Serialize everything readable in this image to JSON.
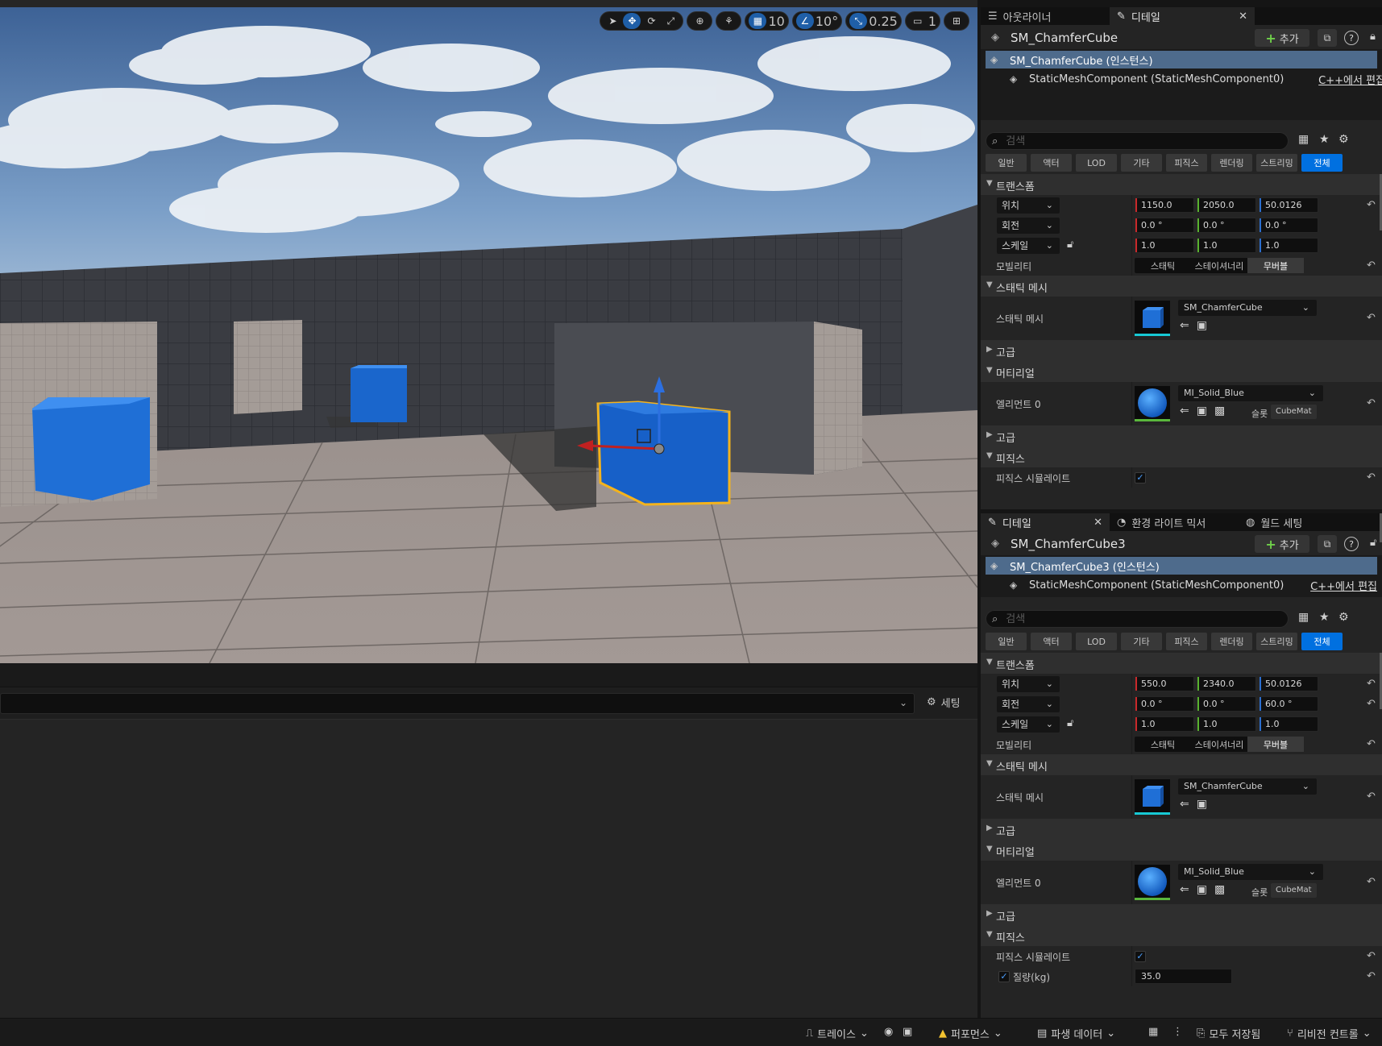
{
  "viewport": {
    "toolbar": {
      "grid_snap": "10",
      "angle_snap": "10°",
      "scale_snap": "0.25",
      "camera_speed": "1"
    }
  },
  "output_log": {
    "settings_label": "세팅"
  },
  "panel_top": {
    "tabs": {
      "outliner": "아웃라이너",
      "details": "디테일"
    },
    "title": "SM_ChamferCube",
    "add_label": "추가",
    "components": {
      "root": "SM_ChamferCube (인스턴스)",
      "child": "StaticMeshComponent (StaticMeshComponent0)",
      "cpp_link": "C++에서 편집"
    },
    "search_placeholder": "검색",
    "filters": [
      "일반",
      "액터",
      "LOD",
      "기타",
      "피직스",
      "렌더링",
      "스트리밍",
      "전체"
    ],
    "transform": {
      "category": "트랜스폼",
      "location_label": "위치",
      "rotation_label": "회전",
      "scale_label": "스케일",
      "location": [
        "1150.0",
        "2050.0",
        "50.0126"
      ],
      "rotation": [
        "0.0 °",
        "0.0 °",
        "0.0 °"
      ],
      "scale": [
        "1.0",
        "1.0",
        "1.0"
      ],
      "mobility_label": "모빌리티",
      "mobility_options": [
        "스태틱",
        "스테이셔너리",
        "무버블"
      ]
    },
    "static_mesh": {
      "category": "스태틱 메시",
      "label": "스태틱 메시",
      "asset": "SM_ChamferCube"
    },
    "advanced_label": "고급",
    "materials": {
      "category": "머티리얼",
      "element_label": "엘리먼트 0",
      "asset": "MI_Solid_Blue",
      "slot_label": "슬롯",
      "slot_value": "CubeMat"
    },
    "physics": {
      "category": "피직스",
      "simulate_label": "피직스 시뮬레이트"
    }
  },
  "panel_bottom": {
    "tabs": {
      "details": "디테일",
      "env_light": "환경 라이트 믹서",
      "world_settings": "월드 세팅"
    },
    "title": "SM_ChamferCube3",
    "add_label": "추가",
    "components": {
      "root": "SM_ChamferCube3 (인스턴스)",
      "child": "StaticMeshComponent (StaticMeshComponent0)",
      "cpp_link": "C++에서 편집"
    },
    "search_placeholder": "검색",
    "filters": [
      "일반",
      "액터",
      "LOD",
      "기타",
      "피직스",
      "렌더링",
      "스트리밍",
      "전체"
    ],
    "transform": {
      "category": "트랜스폼",
      "location_label": "위치",
      "rotation_label": "회전",
      "scale_label": "스케일",
      "location": [
        "550.0",
        "2340.0",
        "50.0126"
      ],
      "rotation": [
        "0.0 °",
        "0.0 °",
        "60.0 °"
      ],
      "scale": [
        "1.0",
        "1.0",
        "1.0"
      ],
      "mobility_label": "모빌리티",
      "mobility_options": [
        "스태틱",
        "스테이셔너리",
        "무버블"
      ]
    },
    "static_mesh": {
      "category": "스태틱 메시",
      "label": "스태틱 메시",
      "asset": "SM_ChamferCube"
    },
    "advanced_label": "고급",
    "materials": {
      "category": "머티리얼",
      "element_label": "엘리먼트 0",
      "asset": "MI_Solid_Blue",
      "slot_label": "슬롯",
      "slot_value": "CubeMat"
    },
    "physics": {
      "category": "피직스",
      "simulate_label": "피직스 시뮬레이트",
      "mass_label": "질량(kg)",
      "mass_value": "35.0"
    }
  },
  "statusbar": {
    "trace": "트레이스",
    "performance": "퍼포먼스",
    "derived_data": "파생 데이터",
    "save_all": "모두 저장됨",
    "revision_control": "리비전 컨트롤"
  },
  "colors": {
    "accent": "#0070e0",
    "selection": "#4e6b8c",
    "cube_blue": "#1f6fd6",
    "highlight": "#f4b31c"
  }
}
